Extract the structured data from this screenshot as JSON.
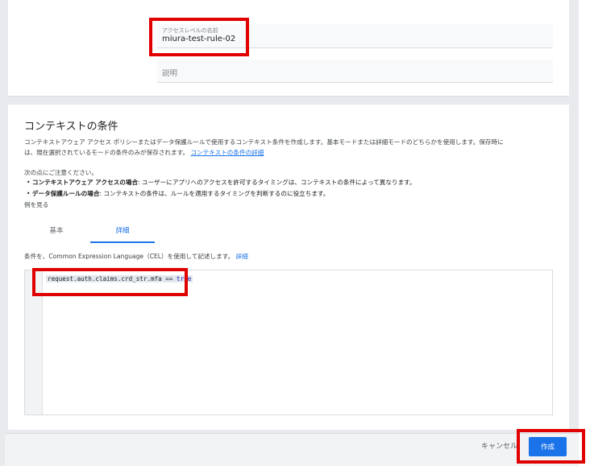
{
  "form": {
    "name_label": "アクセスレベルの名前",
    "name_value": "miura-test-rule-02",
    "description_placeholder": "説明"
  },
  "conditions": {
    "title": "コンテキストの条件",
    "desc_line1": "コンテキストアウェア アクセス ポリシーまたはデータ保護ルールで使用するコンテキスト条件を作成します。基本モードまたは詳細モードのどちらかを使用します。保存時に",
    "desc_line2": "は、現在選択されているモードの条件のみが保存されます。",
    "desc_link": "コンテキストの条件の詳細",
    "note_intro": "次の点にご注意ください。",
    "bullet1_bold": "コンテキストアウェア アクセスの場合",
    "bullet1_text": ": ユーザーにアプリへのアクセスを許可するタイミングは、コンテキストの条件によって異なります。",
    "bullet2_bold": "データ保護ルールの場合",
    "bullet2_text": ": コンテキストの条件は、ルールを適用するタイミングを判断するのに役立ちます。",
    "example_link": "例を見る"
  },
  "tabs": {
    "basic": "基本",
    "advanced": "詳細"
  },
  "cel": {
    "help_text": "条件を、Common Expression Language（CEL）を使用して記述します。",
    "help_link": "詳細",
    "code_expr": "request.auth.claims.crd_str.mfa == ",
    "code_value": "true"
  },
  "footer": {
    "cancel_label": "キャンセル",
    "create_label": "作成"
  },
  "colors": {
    "accent": "#1a73e8",
    "highlight": "#e00000"
  }
}
